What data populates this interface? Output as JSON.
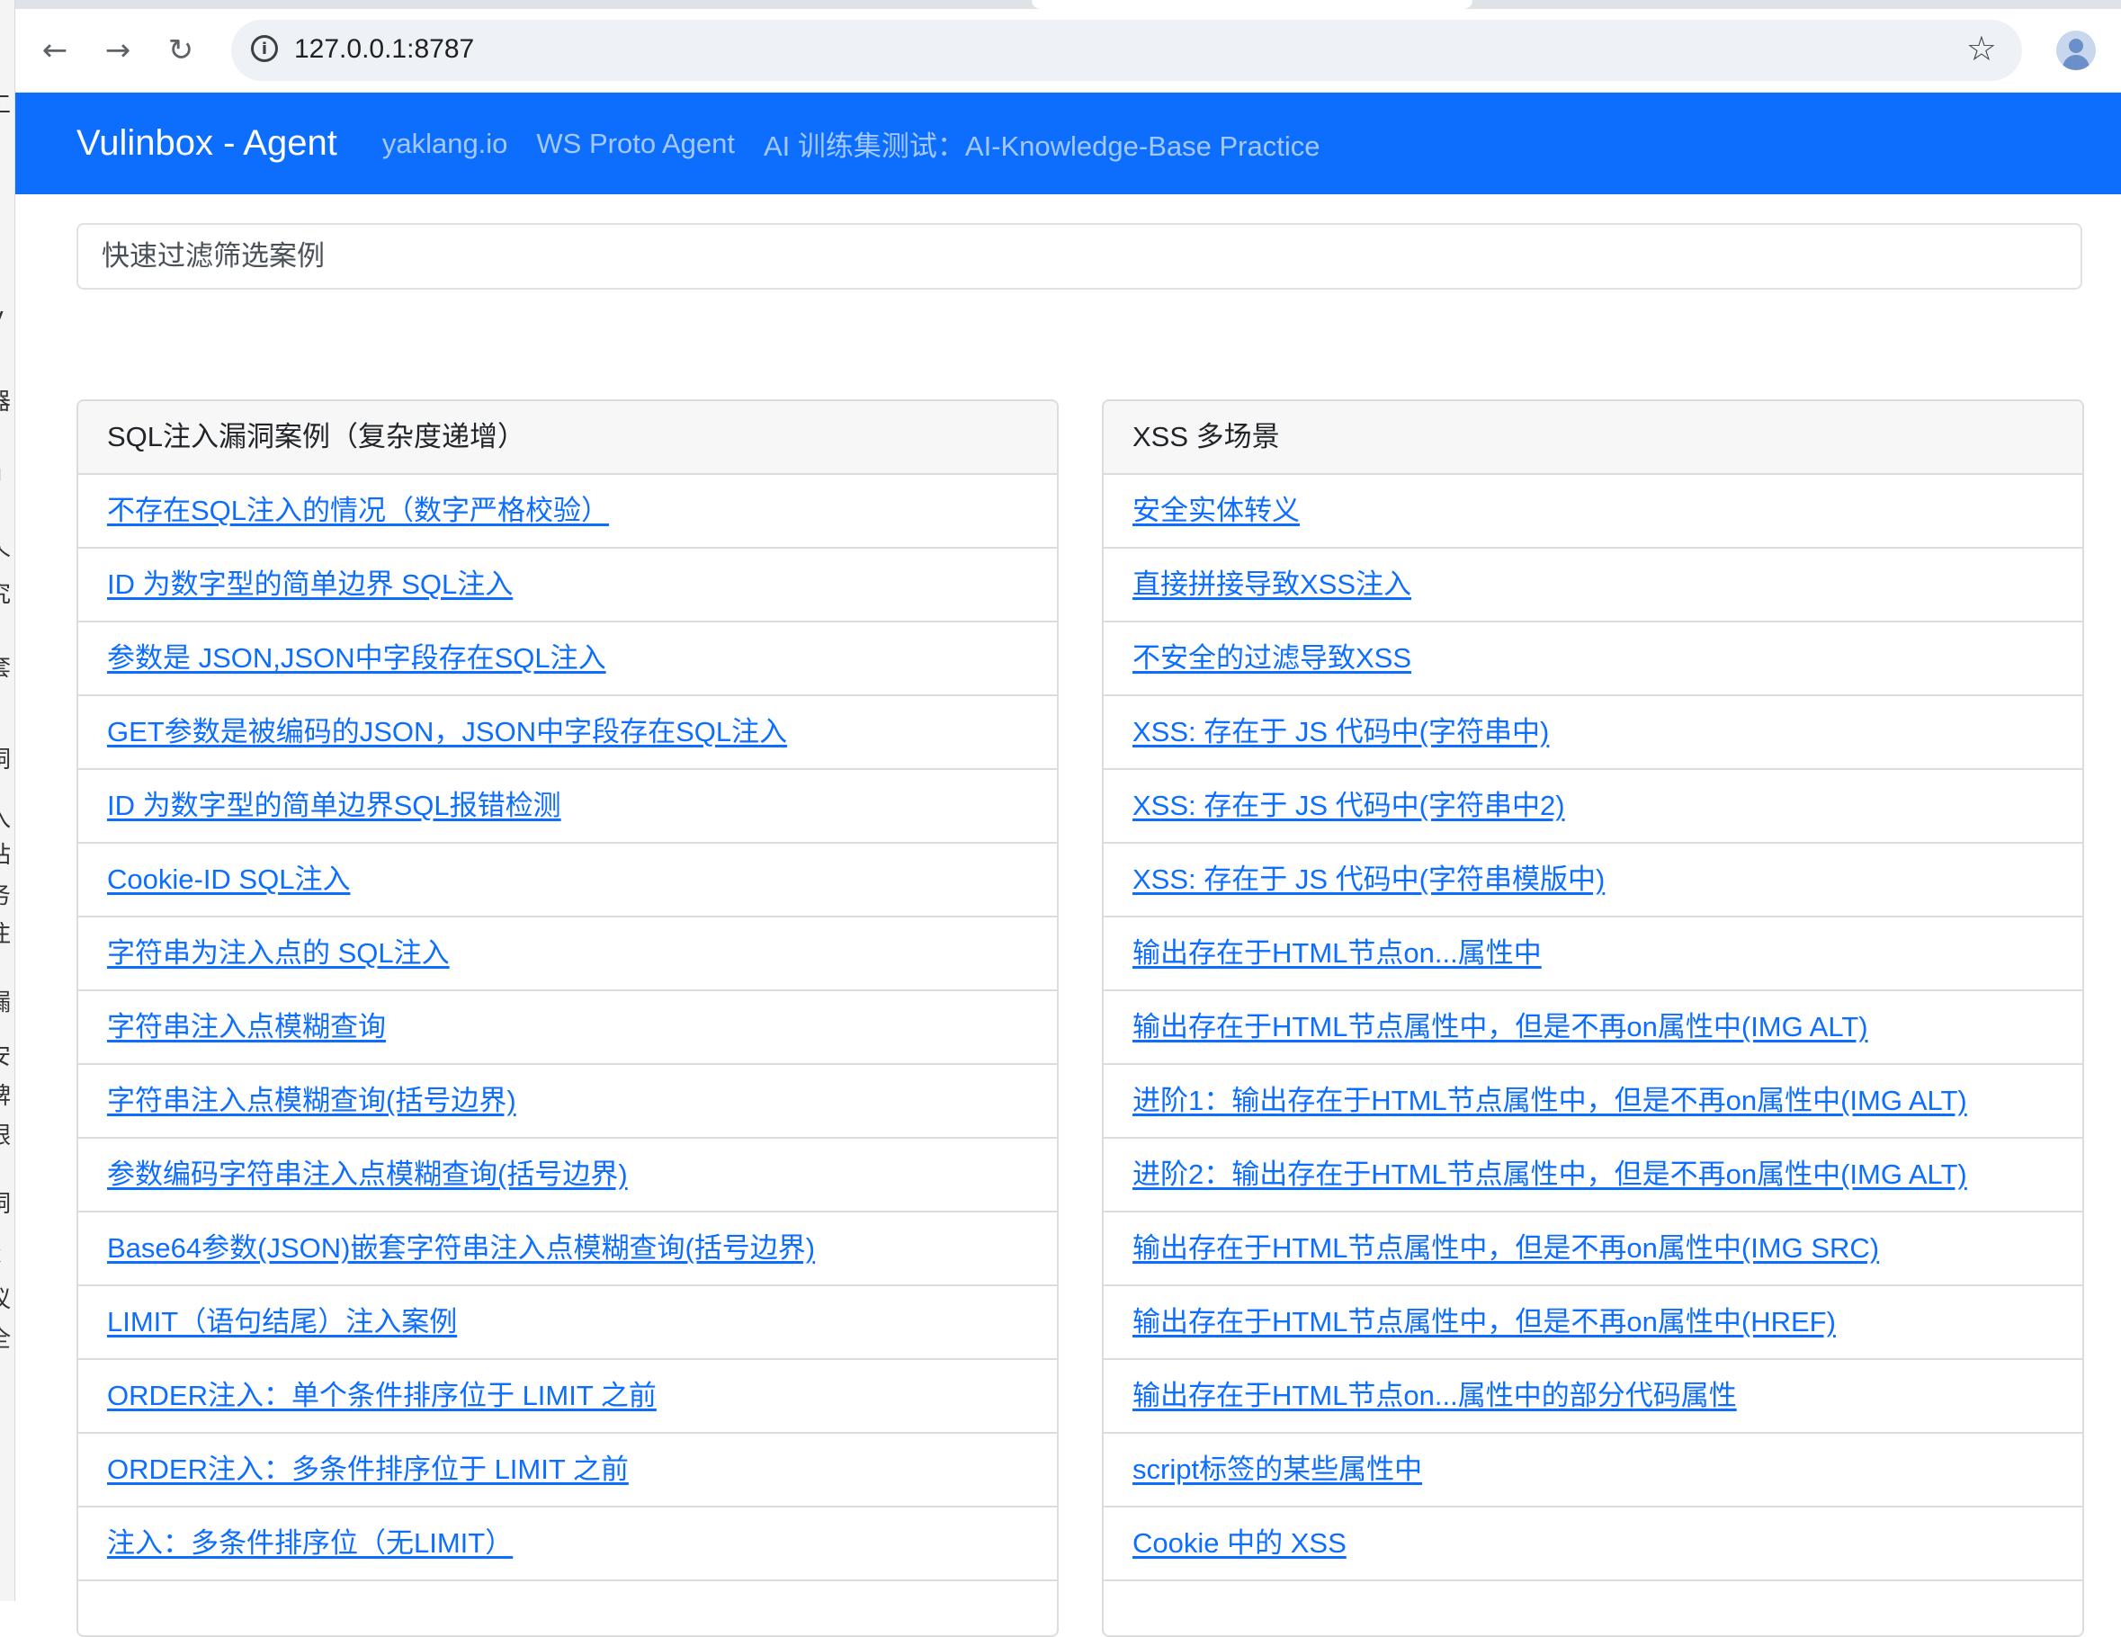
{
  "browser": {
    "url": "127.0.0.1:8787",
    "icons": [
      "back-icon",
      "forward-icon",
      "reload-icon",
      "site-info-icon",
      "bookmark-star-icon",
      "profile-icon"
    ]
  },
  "navbar": {
    "brand": "Vulinbox - Agent",
    "links": [
      "yaklang.io",
      "WS Proto Agent",
      "AI 训练集测试：AI-Knowledge-Base Practice"
    ],
    "bg_color": "#0d6efd"
  },
  "filter": {
    "placeholder": "快速过滤筛选案例"
  },
  "cards": [
    {
      "title": "SQL注入漏洞案例（复杂度递增）",
      "items": [
        "不存在SQL注入的情况（数字严格校验）",
        "ID 为数字型的简单边界 SQL注入",
        "参数是 JSON,JSON中字段存在SQL注入",
        "GET参数是被编码的JSON，JSON中字段存在SQL注入",
        "ID 为数字型的简单边界SQL报错检测",
        "Cookie-ID SQL注入",
        "字符串为注入点的 SQL注入",
        "字符串注入点模糊查询",
        "字符串注入点模糊查询(括号边界)",
        "参数编码字符串注入点模糊查询(括号边界)",
        "Base64参数(JSON)嵌套字符串注入点模糊查询(括号边界)",
        "LIMIT（语句结尾）注入案例",
        "ORDER注入：单个条件排序位于 LIMIT 之前",
        "ORDER注入：多条件排序位于 LIMIT 之前",
        "注入：多条件排序位（无LIMIT）"
      ]
    },
    {
      "title": "XSS 多场景",
      "items": [
        "安全实体转义",
        "直接拼接导致XSS注入",
        "不安全的过滤导致XSS",
        "XSS: 存在于 JS 代码中(字符串中)",
        "XSS: 存在于 JS 代码中(字符串中2)",
        "XSS: 存在于 JS 代码中(字符串模版中)",
        "输出存在于HTML节点on...属性中",
        "输出存在于HTML节点属性中，但是不再on属性中(IMG ALT)",
        "进阶1：输出存在于HTML节点属性中，但是不再on属性中(IMG ALT)",
        "进阶2：输出存在于HTML节点属性中，但是不再on属性中(IMG ALT)",
        "输出存在于HTML节点属性中，但是不再on属性中(IMG SRC)",
        "输出存在于HTML节点属性中，但是不再on属性中(HREF)",
        "输出存在于HTML节点on...属性中的部分代码属性",
        "script标签的某些属性中",
        "Cookie 中的 XSS"
      ]
    }
  ]
}
